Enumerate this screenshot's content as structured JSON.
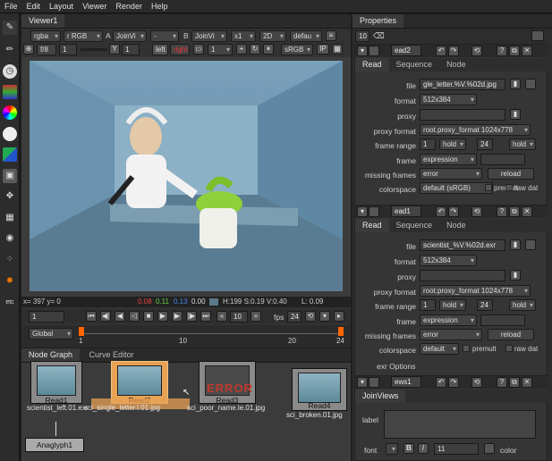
{
  "menubar": {
    "items": [
      "File",
      "Edit",
      "Layout",
      "Viewer",
      "Render",
      "Help"
    ]
  },
  "viewer": {
    "tab": "Viewer1",
    "row1": {
      "channels": "rgba",
      "layer": "r RGB",
      "a_label": "A",
      "a_input": "JoinVi",
      "dash": "-",
      "b_label": "B",
      "b_input": "JoinVi",
      "zoom": "x1",
      "view": "2D",
      "lut": "defau"
    },
    "row2": {
      "fstop": "f/8",
      "gain": "1",
      "y_label": "Y",
      "gamma": "1",
      "left": "left",
      "right": "right",
      "frame": "1",
      "colorspace": "sRGB",
      "ip": "IP"
    },
    "status": {
      "coords": "x= 397 y= 0",
      "r": "0.08",
      "g": "0.11",
      "b": "0.13",
      "a": "0.00",
      "hsv": "H:199 S:0.19 V:0.40",
      "l": "L: 0.09"
    },
    "playback": {
      "frame": "1",
      "step": "10",
      "fps_label": "fps",
      "fps": "24",
      "end": "24"
    },
    "timeline": {
      "range": "Global",
      "ticks": [
        "1",
        "10",
        "20",
        "24"
      ]
    }
  },
  "nodegraph": {
    "tabs": [
      "Node Graph",
      "Curve Editor"
    ],
    "nodes": [
      {
        "name": "Read1",
        "file": "scientist_left.01.exr"
      },
      {
        "name": "Read2",
        "file": "sci_single_letter.l.01.jpg"
      },
      {
        "name": "Read3",
        "file": "sci_poor_name.le.01.jpg",
        "error": "ERROR"
      },
      {
        "name": "Read4",
        "file": "sci_broken.01.jpg"
      },
      {
        "name": "Anaglyph1",
        "file": ""
      }
    ]
  },
  "properties": {
    "tab": "Properties",
    "max_panels": "10",
    "panels": [
      {
        "name": "ead2",
        "tabs": [
          "Read",
          "Sequence",
          "Node"
        ],
        "file": "gle_letter.%V.%02d.jpg",
        "format": "512x384",
        "proxy": "",
        "proxy_format": "root.proxy_format 1024x778",
        "fr_start": "1",
        "fr_before": "hold",
        "fr_end": "24",
        "fr_after": "hold",
        "frame_mode": "expression",
        "missing": "error",
        "reload": "reload",
        "colorspace": "default (sRGB)",
        "premult": "premult",
        "raw": "raw dat"
      },
      {
        "name": "ead1",
        "tabs": [
          "Read",
          "Sequence",
          "Node"
        ],
        "file": "scientist_%V.%02d.exr",
        "format": "512x384",
        "proxy": "",
        "proxy_format": "root.proxy_format 1024x778",
        "fr_start": "1",
        "fr_before": "hold",
        "fr_end": "24",
        "fr_after": "hold",
        "frame_mode": "expression",
        "missing": "error",
        "reload": "reload",
        "colorspace": "default",
        "premult": "premult",
        "raw": "raw dat",
        "exr": "exr Options"
      },
      {
        "name": "ews1",
        "tabs": [
          "JoinViews"
        ],
        "label": "label",
        "font": "font",
        "font_size": "11",
        "color": "color"
      }
    ],
    "labels": {
      "file": "file",
      "format": "format",
      "proxy": "proxy",
      "proxy_format": "proxy format",
      "frame_range": "frame range",
      "frame": "frame",
      "missing": "missing frames",
      "colorspace": "colorspace"
    }
  }
}
